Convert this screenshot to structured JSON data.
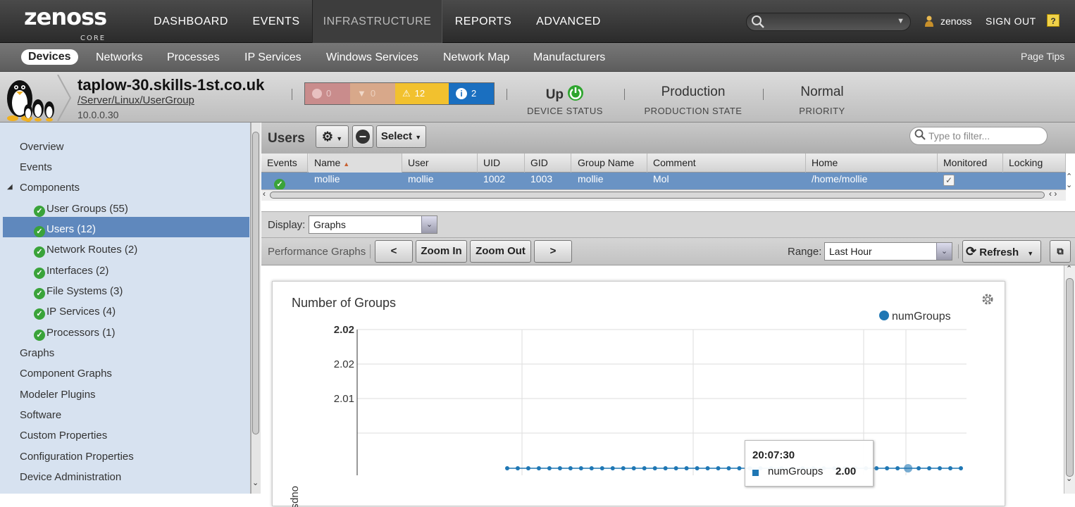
{
  "app": {
    "logo": "zenoss",
    "logo_sub": "CORE"
  },
  "topnav": {
    "items": [
      "DASHBOARD",
      "EVENTS",
      "INFRASTRUCTURE",
      "REPORTS",
      "ADVANCED"
    ],
    "active": "INFRASTRUCTURE",
    "username": "zenoss",
    "signout": "SIGN OUT",
    "help": "?"
  },
  "subnav": {
    "items": [
      "Devices",
      "Networks",
      "Processes",
      "IP Services",
      "Windows Services",
      "Network Map",
      "Manufacturers"
    ],
    "active": "Devices",
    "page_tips": "Page Tips"
  },
  "device": {
    "name": "taplow-30.skills-1st.co.uk",
    "path": "/Server/Linux/UserGroup",
    "ip": "10.0.0.30",
    "events": {
      "critical": "0",
      "error": "0",
      "warning": "12",
      "info": "2"
    },
    "status_value": "Up",
    "status_label": "DEVICE STATUS",
    "production_value": "Production",
    "production_label": "PRODUCTION STATE",
    "priority_value": "Normal",
    "priority_label": "PRIORITY"
  },
  "sidebar": {
    "items": [
      "Overview",
      "Events",
      "Components"
    ],
    "components": [
      {
        "label": "User Groups (55)"
      },
      {
        "label": "Users (12)",
        "selected": true
      },
      {
        "label": "Network Routes (2)"
      },
      {
        "label": "Interfaces (2)"
      },
      {
        "label": "File Systems (3)"
      },
      {
        "label": "IP Services (4)"
      },
      {
        "label": "Processors (1)"
      }
    ],
    "items_after": [
      "Graphs",
      "Component Graphs",
      "Modeler Plugins",
      "Software",
      "Custom Properties",
      "Configuration Properties",
      "Device Administration"
    ]
  },
  "grid": {
    "title": "Users",
    "select_label": "Select",
    "filter_placeholder": "Type to filter...",
    "columns": [
      "Events",
      "Name",
      "User",
      "UID",
      "GID",
      "Group Name",
      "Comment",
      "Home",
      "Monitored",
      "Locking"
    ],
    "sorted_column": "Name",
    "rows": [
      {
        "name": "mollie",
        "user": "mollie",
        "uid": "1002",
        "gid": "1003",
        "group": "mollie",
        "comment": "Mol",
        "home": "/home/mollie",
        "monitored": true
      }
    ]
  },
  "display": {
    "label": "Display:",
    "value": "Graphs"
  },
  "perf": {
    "label": "Performance Graphs",
    "prev": "<",
    "zoom_in": "Zoom In",
    "zoom_out": "Zoom Out",
    "next": ">",
    "range_label": "Range:",
    "range_value": "Last Hour",
    "refresh": "Refresh"
  },
  "chart_data": {
    "type": "line",
    "title": "Number of Groups",
    "ylabel": "...oups",
    "ylim": [
      2.0,
      2.02
    ],
    "y_ticks": [
      "2.02",
      "2.02",
      "2.01"
    ],
    "legend_position": "top-right",
    "series": [
      {
        "name": "numGroups",
        "color": "#1f77b4",
        "values": [
          2,
          2,
          2,
          2,
          2,
          2,
          2,
          2,
          2,
          2,
          2,
          2,
          2,
          2,
          2,
          2,
          2,
          2,
          2,
          2,
          2,
          2,
          2,
          2,
          2,
          2,
          2,
          2,
          2,
          2,
          2,
          2,
          2,
          2,
          2,
          2,
          2,
          2,
          2,
          2,
          2,
          2,
          2,
          2
        ]
      }
    ],
    "tooltip": {
      "time": "20:07:30",
      "series": "numGroups",
      "value": "2.00"
    },
    "colors": {
      "series": "#1f77b4"
    }
  }
}
